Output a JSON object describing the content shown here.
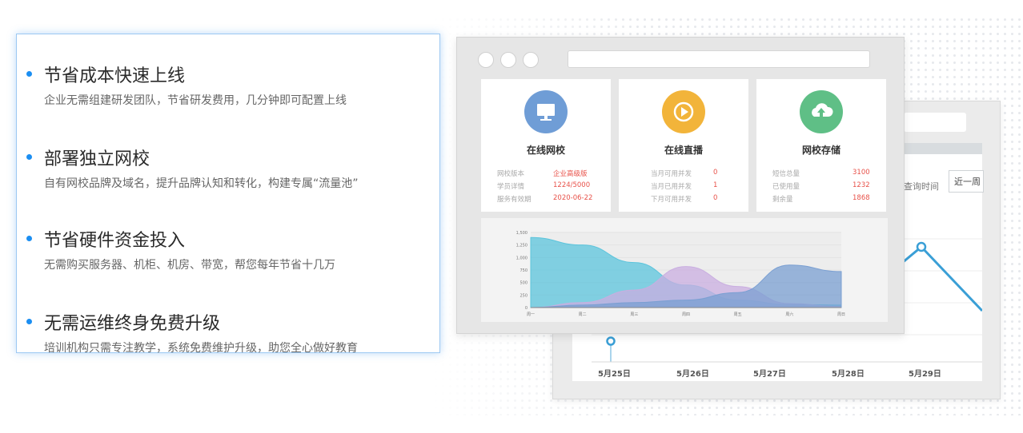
{
  "features": [
    {
      "title": "节省成本快速上线",
      "desc": "企业无需组建研发团队，节省研发费用，几分钟即可配置上线"
    },
    {
      "title": "部署独立网校",
      "desc": "自有网校品牌及域名，提升品牌认知和转化，构建专属“流量池”"
    },
    {
      "title": "节省硬件资金投入",
      "desc": "无需购买服务器、机柜、机房、带宽，帮您每年节省十几万"
    },
    {
      "title": "无需运维终身免费升级",
      "desc": "培训机构只需专注教学，系统免费维护升级，助您全心做好教育"
    }
  ],
  "cards": [
    {
      "title": "在线网校",
      "icon": "monitor-icon",
      "color": "#6f9dd6",
      "rows": [
        {
          "k": "网校版本",
          "v": "企业高级版"
        },
        {
          "k": "学员详情",
          "v": "1224/5000"
        },
        {
          "k": "服务有效期",
          "v": "2020-06-22"
        }
      ]
    },
    {
      "title": "在线直播",
      "icon": "play-icon",
      "color": "#f2b43a",
      "rows": [
        {
          "k": "当月可用并发",
          "v": "0"
        },
        {
          "k": "当月已用并发",
          "v": "1"
        },
        {
          "k": "下月可用并发",
          "v": "0"
        }
      ]
    },
    {
      "title": "网校存储",
      "icon": "cloud-upload-icon",
      "color": "#5fbf86",
      "rows": [
        {
          "k": "短信总量",
          "v": "3100"
        },
        {
          "k": "已使用量",
          "v": "1232"
        },
        {
          "k": "剩余量",
          "v": "1868"
        }
      ]
    }
  ],
  "back_window": {
    "label": "查询时间",
    "select": "近一周",
    "dates": [
      "5月25日",
      "5月26日",
      "5月27日",
      "5月28日",
      "5月29日"
    ]
  },
  "chart_data": {
    "type": "area",
    "y_ticks": [
      "1,500",
      "1,250",
      "1,000",
      "750",
      "500",
      "250",
      "0"
    ],
    "x_ticks": [
      "周一",
      "周二",
      "周三",
      "周四",
      "周五",
      "周六",
      "周日"
    ],
    "ylim": [
      0,
      1500
    ],
    "series": [
      {
        "color": "#5bc4dc",
        "values": [
          1400,
          1250,
          900,
          450,
          150,
          60,
          50
        ]
      },
      {
        "color": "#c9aee0",
        "values": [
          0,
          100,
          350,
          820,
          420,
          80,
          20
        ]
      },
      {
        "color": "#7a9fd2",
        "values": [
          0,
          50,
          100,
          150,
          300,
          850,
          720
        ]
      }
    ]
  }
}
